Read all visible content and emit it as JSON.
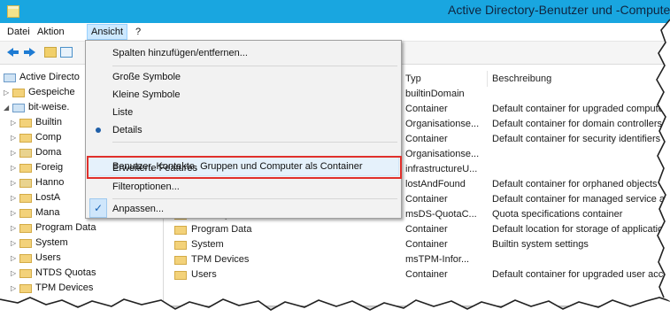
{
  "window": {
    "title": "Active Directory-Benutzer und -Computer"
  },
  "menubar": {
    "items": [
      "Datei",
      "Aktion",
      "Ansicht",
      "?"
    ]
  },
  "dropdown": {
    "items": [
      {
        "label": "Spalten hinzufügen/entfernen..."
      },
      {
        "label": "Große Symbole"
      },
      {
        "label": "Kleine Symbole"
      },
      {
        "label": "Liste"
      },
      {
        "label": "Details"
      },
      {
        "label": "Benutzer, Kontakte, Gruppen und Computer als Container"
      },
      {
        "label": "Erweiterte Features"
      },
      {
        "label": "Filteroptionen..."
      },
      {
        "label": "Anpassen..."
      }
    ],
    "selected_view": "Details",
    "checked": "Erweiterte Features",
    "check_glyph": "✓"
  },
  "tree": {
    "items": [
      {
        "label": "Active Directo",
        "chev": ""
      },
      {
        "label": "Gespeiche",
        "chev": "▷"
      },
      {
        "label": "bit-weise.",
        "chev": "◢"
      },
      {
        "label": "Builtin",
        "chev": "▷"
      },
      {
        "label": "Comp",
        "chev": "▷"
      },
      {
        "label": "Doma",
        "chev": "▷"
      },
      {
        "label": "Foreig",
        "chev": "▷"
      },
      {
        "label": "Hanno",
        "chev": "▷"
      },
      {
        "label": "LostA",
        "chev": "▷"
      },
      {
        "label": "Mana",
        "chev": "▷"
      },
      {
        "label": "Program Data",
        "chev": "▷"
      },
      {
        "label": "System",
        "chev": "▷"
      },
      {
        "label": "Users",
        "chev": "▷"
      },
      {
        "label": "NTDS Quotas",
        "chev": "▷"
      },
      {
        "label": "TPM Devices",
        "chev": "▷"
      }
    ]
  },
  "list": {
    "columns": [
      "Typ",
      "Beschreibung"
    ],
    "rows": [
      {
        "name": "",
        "type": "builtinDomain",
        "desc": ""
      },
      {
        "name": "",
        "type": "Container",
        "desc": "Default container for upgraded computer"
      },
      {
        "name": "",
        "type": "Organisationse...",
        "desc": "Default container for domain controllers"
      },
      {
        "name": "",
        "type": "Container",
        "desc": "Default container for security identifiers ("
      },
      {
        "name": "",
        "type": "Organisationse...",
        "desc": ""
      },
      {
        "name": "",
        "type": "infrastructureU...",
        "desc": ""
      },
      {
        "name": "",
        "type": "lostAndFound",
        "desc": "Default container for orphaned objects"
      },
      {
        "name": "",
        "type": "Container",
        "desc": "Default container for managed service acc"
      },
      {
        "name": "NTDS Quotas",
        "type": "msDS-QuotaC...",
        "desc": "Quota specifications container"
      },
      {
        "name": "Program Data",
        "type": "Container",
        "desc": "Default location for storage of application"
      },
      {
        "name": "System",
        "type": "Container",
        "desc": "Builtin system settings"
      },
      {
        "name": "TPM Devices",
        "type": "msTPM-Infor...",
        "desc": ""
      },
      {
        "name": "Users",
        "type": "Container",
        "desc": "Default container for upgraded user accou"
      }
    ]
  },
  "colors": {
    "titlebar": "#19a6e0",
    "highlight_border": "#e0302b",
    "menu_active": "#cce8ff"
  }
}
